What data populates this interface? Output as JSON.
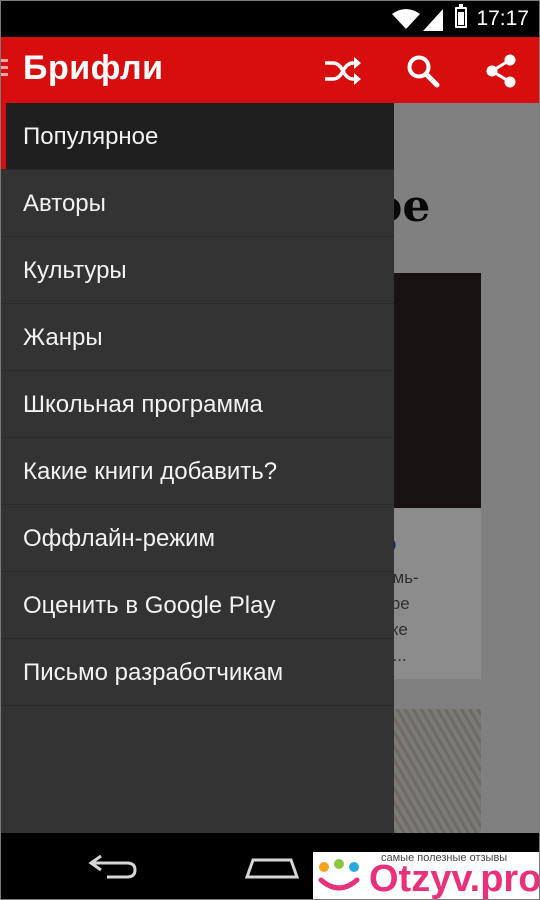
{
  "status_bar": {
    "time": "17:17"
  },
  "app_bar": {
    "title": "Брифли",
    "icons": [
      "shuffle-icon",
      "search-icon",
      "share-icon"
    ]
  },
  "drawer": {
    "items": [
      {
        "label": "Популярное",
        "active": true
      },
      {
        "label": "Авторы"
      },
      {
        "label": "Культуры"
      },
      {
        "label": "Жанры"
      },
      {
        "label": "Школьная программа"
      },
      {
        "label": "Какие книги добавить?"
      },
      {
        "label": "Оффлайн-режим"
      },
      {
        "label": "Оценить в Google Play"
      },
      {
        "label": "Письмо разработчикам"
      }
    ]
  },
  "background": {
    "heading_fragment": "ое",
    "card_title_fragment": "о",
    "card_desc_fragment": "емь-\nтре\nтке\nо..."
  },
  "watermark": {
    "tagline": "самые полезные отзывы",
    "brand": "Otzyv.pro"
  },
  "colors": {
    "accent": "#d80e0e",
    "drawer_bg": "#333333",
    "drawer_active_bg": "#1f1f1f"
  }
}
